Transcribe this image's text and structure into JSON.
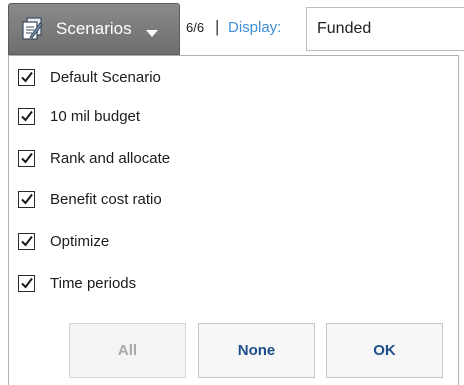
{
  "toolbar": {
    "scenarios_label": "Scenarios",
    "count": "6/6",
    "separator": "|",
    "display_label": "Display:",
    "display_value": "Funded",
    "icons": {
      "scenarios": "scenario-document-icon",
      "dropdown": "caret-down-icon"
    }
  },
  "scenarios": [
    {
      "label": "Default Scenario",
      "checked": true
    },
    {
      "label": "10 mil budget",
      "checked": true
    },
    {
      "label": "Rank and allocate",
      "checked": true
    },
    {
      "label": "Benefit cost ratio",
      "checked": true
    },
    {
      "label": "Optimize",
      "checked": true
    },
    {
      "label": "Time periods",
      "checked": true
    }
  ],
  "buttons": {
    "all": "All",
    "none": "None",
    "ok": "OK"
  },
  "colors": {
    "display_label": "#3d8fd6",
    "button_text": "#1f4e8c",
    "button_disabled": "#a9a9a9",
    "scenarios_bg": "#7a7a7a"
  }
}
